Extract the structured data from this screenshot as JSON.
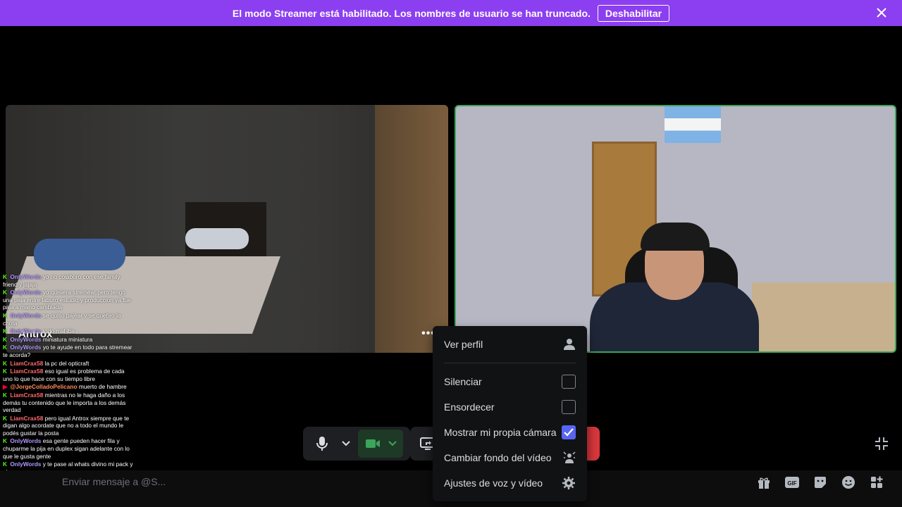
{
  "banner": {
    "text": "El modo Streamer está habilitado. Los nombres de usuario se han truncado.",
    "button": "Deshabilitar"
  },
  "tiles": {
    "left_name": "Antrox"
  },
  "chat": [
    {
      "platform": "kick",
      "user": "OnlyWords",
      "text": "yo no colaboro con ese family friendly jajaja",
      "color": "purple"
    },
    {
      "platform": "kick",
      "user": "OnlyWords",
      "text": "yo quisiera stremear pero tengo una paja entre laburo estudio y produccion ya fue paja a mano cambiada",
      "color": "purple"
    },
    {
      "platform": "kick",
      "user": "OnlyWords",
      "text": "se quiso pajear y se quebro la chota",
      "color": "purple"
    },
    {
      "platform": "kick",
      "user": "OnlyWords",
      "text": "todo mal iba",
      "color": "purple"
    },
    {
      "platform": "kick",
      "user": "OnlyWords",
      "text": "miniatura miniatura",
      "color": "purple"
    },
    {
      "platform": "kick",
      "user": "OnlyWords",
      "text": "yo te ayude en todo para stremear te acorda?",
      "color": "purple"
    },
    {
      "platform": "kick",
      "user": "LiamCrax58",
      "text": "la pc del opticraft",
      "color": "red"
    },
    {
      "platform": "kick",
      "user": "LiamCrax58",
      "text": "eso igual es problema de cada uno lo que hace con su tiempo libre",
      "color": "red"
    },
    {
      "platform": "youtube",
      "user": "@JorgeColladoPelicano",
      "text": "muerto de hambre",
      "color": "orange"
    },
    {
      "platform": "kick",
      "user": "LiamCrax58",
      "text": "mientras no le haga daño a los demás tu contenido que le importa a los demás verdad",
      "color": "red"
    },
    {
      "platform": "kick",
      "user": "LiamCrax58",
      "text": "pero igual Antrox siempre que te digan algo acordate que no a todo el mundo le podés gustar la posta",
      "color": "red"
    },
    {
      "platform": "kick",
      "user": "OnlyWords",
      "text": "esa gente pueden hacer fila y chuparme la pija en duplex sigan adelante con lo que le gusta gente",
      "color": "purple"
    },
    {
      "platform": "kick",
      "user": "OnlyWords",
      "text": "y te pase al whats divino mi pack y algo mas",
      "color": "purple"
    }
  ],
  "message_bar": {
    "placeholder": "Enviar mensaje a @S..."
  },
  "menu": {
    "items": [
      {
        "label": "Ver perfil",
        "icon": "person-icon"
      },
      {
        "label": "Silenciar",
        "checked": false
      },
      {
        "label": "Ensordecer",
        "checked": false
      },
      {
        "label": "Mostrar mi propia cámara",
        "checked": true
      },
      {
        "label": "Cambiar fondo del vídeo",
        "icon": "background-icon"
      },
      {
        "label": "Ajustes de voz y vídeo",
        "icon": "gear-icon"
      }
    ]
  },
  "colors": {
    "banner": "#8c3ff0",
    "accent": "#5865f2",
    "speaking_border": "#3ba55c",
    "leave": "#da373c"
  }
}
